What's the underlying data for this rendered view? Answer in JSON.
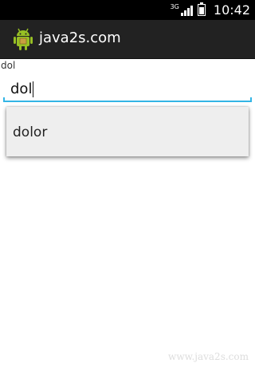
{
  "status_bar": {
    "network_type": "3G",
    "time": "10:42",
    "signal_bars": 4,
    "battery_level": 0.8
  },
  "action_bar": {
    "app_icon": "android-robot-icon",
    "title": "java2s.com"
  },
  "form": {
    "label": "dol",
    "input_value": "dol"
  },
  "dropdown": {
    "items": [
      {
        "label": "dolor"
      }
    ]
  },
  "watermark": "www.java2s.com",
  "colors": {
    "accent": "#33b5e5",
    "action_bar_bg": "#222222",
    "status_bar_bg": "#000000",
    "dropdown_bg": "#eeeeee"
  }
}
